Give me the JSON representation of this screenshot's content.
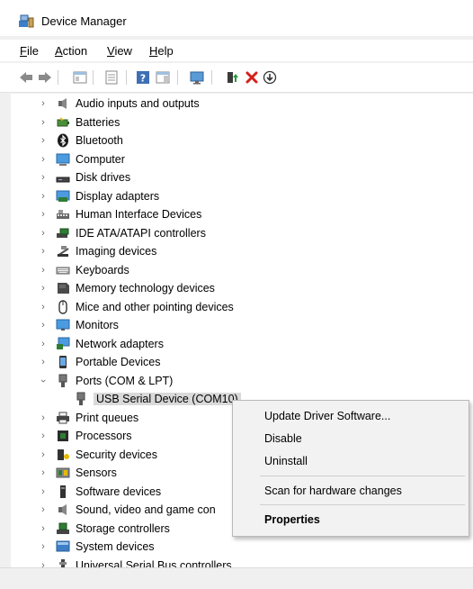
{
  "window": {
    "title": "Device Manager"
  },
  "menu": [
    {
      "label": "File",
      "accel": "F",
      "rest": "ile"
    },
    {
      "label": "Action",
      "accel": "A",
      "rest": "ction"
    },
    {
      "label": "View",
      "accel": "V",
      "rest": "iew"
    },
    {
      "label": "Help",
      "accel": "H",
      "rest": "elp"
    }
  ],
  "toolbar_icons": [
    "back-arrow-icon",
    "forward-arrow-icon",
    "show-hide-tree-icon",
    "properties-icon",
    "help-icon",
    "action-pane-icon",
    "monitor-icon",
    "update-driver-icon",
    "uninstall-icon",
    "enable-device-icon"
  ],
  "tree": {
    "categories": [
      {
        "label": "Audio inputs and outputs",
        "icon": "speaker-icon"
      },
      {
        "label": "Batteries",
        "icon": "battery-icon"
      },
      {
        "label": "Bluetooth",
        "icon": "bluetooth-icon"
      },
      {
        "label": "Computer",
        "icon": "computer-icon"
      },
      {
        "label": "Disk drives",
        "icon": "disk-drive-icon"
      },
      {
        "label": "Display adapters",
        "icon": "display-adapter-icon"
      },
      {
        "label": "Human Interface Devices",
        "icon": "hid-icon"
      },
      {
        "label": "IDE ATA/ATAPI controllers",
        "icon": "ide-controller-icon"
      },
      {
        "label": "Imaging devices",
        "icon": "camera-icon"
      },
      {
        "label": "Keyboards",
        "icon": "keyboard-icon"
      },
      {
        "label": "Memory technology devices",
        "icon": "memory-icon"
      },
      {
        "label": "Mice and other pointing devices",
        "icon": "mouse-icon"
      },
      {
        "label": "Monitors",
        "icon": "monitor-icon"
      },
      {
        "label": "Network adapters",
        "icon": "network-icon"
      },
      {
        "label": "Portable Devices",
        "icon": "portable-device-icon"
      },
      {
        "label": "Ports (COM & LPT)",
        "icon": "port-icon",
        "expanded": true
      },
      {
        "label": "USB Serial Device (COM10)",
        "icon": "usb-plug-icon",
        "child": true,
        "selected": true
      },
      {
        "label": "Print queues",
        "icon": "printer-icon"
      },
      {
        "label": "Processors",
        "icon": "processor-icon"
      },
      {
        "label": "Security devices",
        "icon": "security-device-icon"
      },
      {
        "label": "Sensors",
        "icon": "sensor-icon"
      },
      {
        "label": "Software devices",
        "icon": "software-device-icon"
      },
      {
        "label": "Sound, video and game con",
        "icon": "sound-icon"
      },
      {
        "label": "Storage controllers",
        "icon": "storage-controller-icon"
      },
      {
        "label": "System devices",
        "icon": "system-device-icon"
      },
      {
        "label": "Universal Serial Bus controllers",
        "icon": "usb-controller-icon"
      }
    ]
  },
  "context_menu": {
    "items": [
      {
        "label": "Update Driver Software..."
      },
      {
        "label": "Disable"
      },
      {
        "label": "Uninstall"
      },
      {
        "label": "Scan for hardware changes"
      },
      {
        "label": "Properties"
      }
    ]
  }
}
